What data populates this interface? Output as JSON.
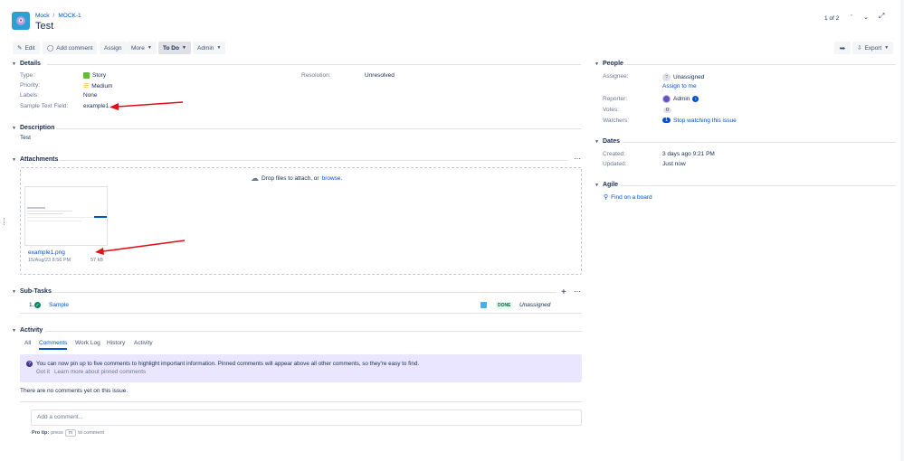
{
  "header": {
    "breadcrumb_project": "Mock",
    "breadcrumb_sep": "/",
    "breadcrumb_key": "MOCK-1",
    "title": "Test",
    "pager": "1 of 2"
  },
  "toolbar": {
    "edit": "Edit",
    "add_comment": "Add comment",
    "assign": "Assign",
    "more": "More",
    "status": "To Do",
    "admin": "Admin",
    "export": "Export"
  },
  "details": {
    "heading": "Details",
    "type_label": "Type:",
    "type_value": "Story",
    "priority_label": "Priority:",
    "priority_value": "Medium",
    "labels_label": "Labels:",
    "labels_value": "None",
    "sample_label": "Sample Text Field:",
    "sample_value": "example1",
    "resolution_label": "Resolution:",
    "resolution_value": "Unresolved"
  },
  "description": {
    "heading": "Description",
    "text": "Test"
  },
  "attachments": {
    "heading": "Attachments",
    "drop_text": "Drop files to attach, or",
    "browse": "browse.",
    "file_name": "example1.png",
    "file_date": "15/Aug/23 8:56 PM",
    "file_size": "57 kB"
  },
  "subtasks": {
    "heading": "Sub-Tasks",
    "row_index": "1.",
    "row_name": "Sample",
    "row_status": "DONE",
    "row_assignee": "Unassigned"
  },
  "activity": {
    "heading": "Activity",
    "tabs": [
      "All",
      "Comments",
      "Work Log",
      "History",
      "Activity"
    ],
    "banner_text": "You can now pin up to five comments to highlight important information. Pinned comments will appear above all other comments, so they're easy to find.",
    "got_it": "Got it",
    "learn_more": "Learn more about pinned comments",
    "no_comments": "There are no comments yet on this issue.",
    "comment_placeholder": "Add a comment...",
    "protip_prefix": "Pro tip:",
    "protip_press": "press",
    "protip_key": "m",
    "protip_suffix": "to comment"
  },
  "people": {
    "heading": "People",
    "assignee_label": "Assignee:",
    "assignee_value": "Unassigned",
    "assign_to_me": "Assign to me",
    "reporter_label": "Reporter:",
    "reporter_value": "Admin",
    "votes_label": "Votes:",
    "votes_value": "0",
    "watchers_label": "Watchers:",
    "watchers_count": "1",
    "stop_watching": "Stop watching this issue"
  },
  "dates": {
    "heading": "Dates",
    "created_label": "Created:",
    "created_value": "3 days ago 9:21 PM",
    "updated_label": "Updated:",
    "updated_value": "Just now"
  },
  "agile": {
    "heading": "Agile",
    "find_on_board": "Find on a board"
  },
  "colors": {
    "link": "#0052cc",
    "story_green": "#63ba3c",
    "priority_orange": "#ffab00",
    "done_green": "#00875a",
    "annotation_red": "#e0101a",
    "banner_bg": "#eae6ff"
  }
}
